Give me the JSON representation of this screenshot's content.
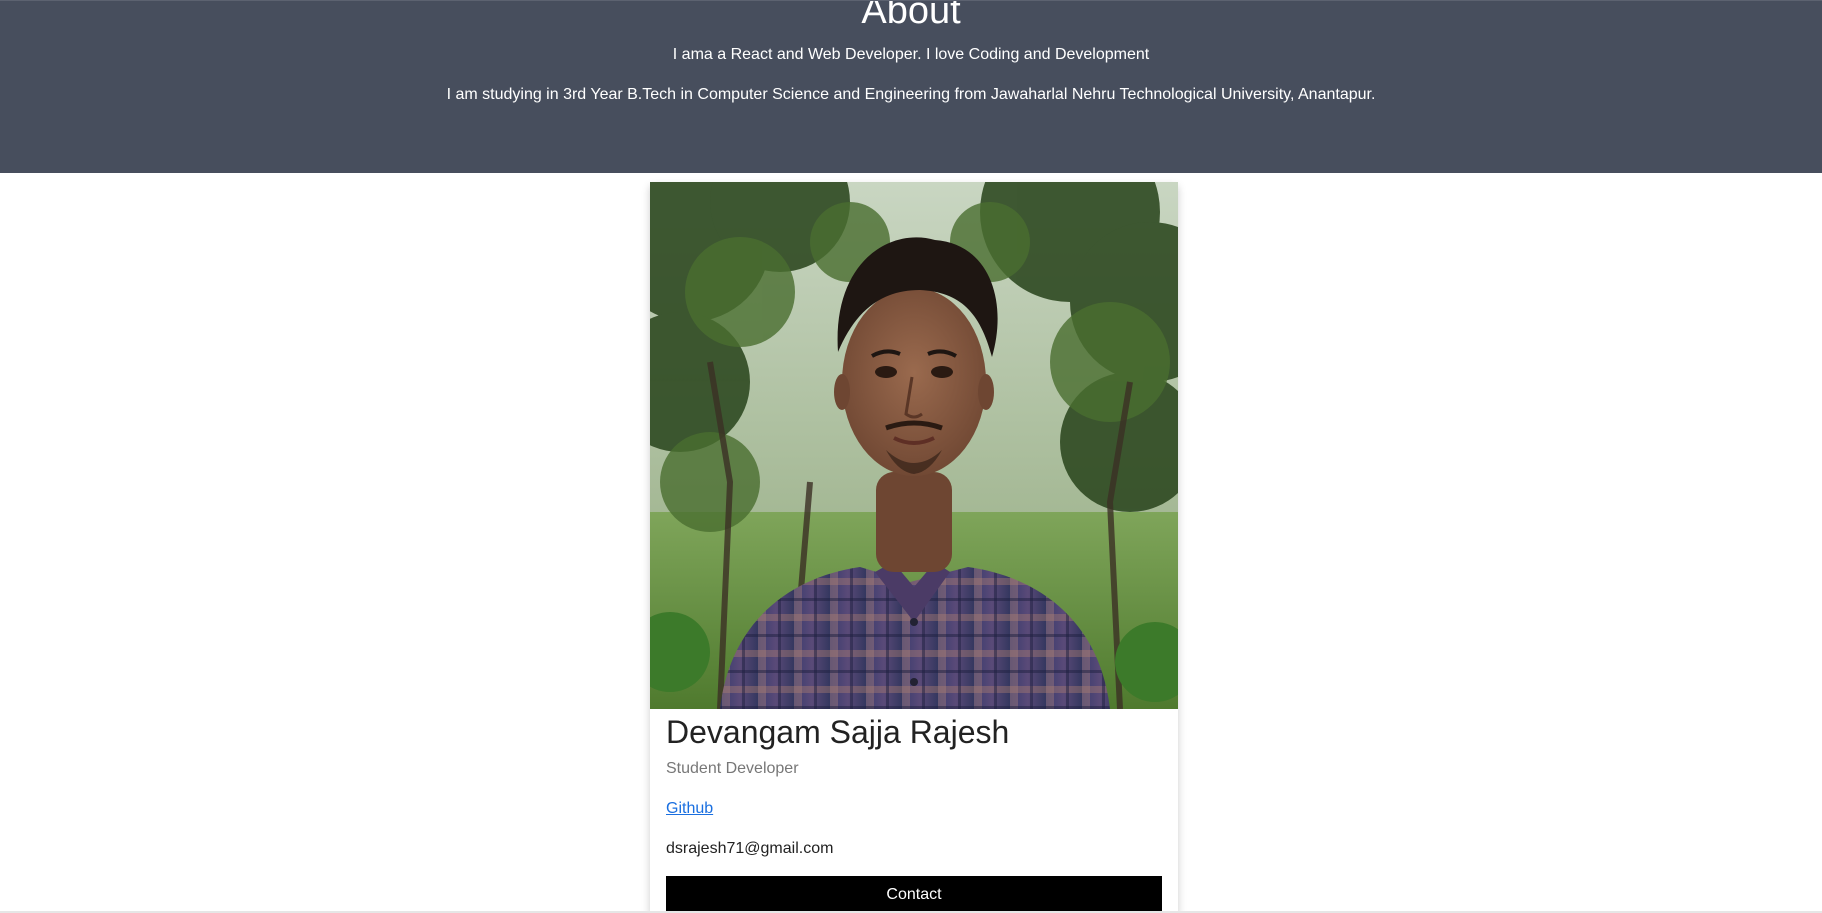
{
  "header": {
    "title": "About",
    "line1": "I ama a React and Web Developer. I love Coding and Development",
    "line2": "I am studying in 3rd Year B.Tech in Computer Science and Engineering from Jawaharlal Nehru Technological University, Anantapur."
  },
  "card": {
    "photo_alt": "Devangam Sajja Rajesh",
    "name": "Devangam Sajja Rajesh",
    "role": "Student Developer",
    "github_label": "Github",
    "email": "dsrajesh71@gmail.com",
    "contact_label": "Contact"
  },
  "colors": {
    "header_bg": "#474e5d",
    "link": "#1a6fe0",
    "button_bg": "#000000"
  }
}
